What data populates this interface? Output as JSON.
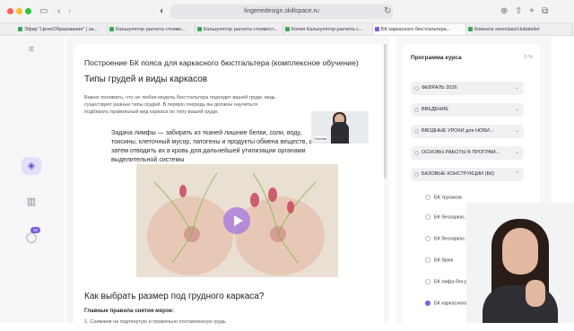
{
  "browser": {
    "url": "lingeriedesign.skillspace.ru",
    "tabs": [
      {
        "label": "Эфир \"ЦеноОбразование\" | за..."
      },
      {
        "label": "Калькулятор расчета стоимо..."
      },
      {
        "label": "Калькулятор расчета стоимост..."
      },
      {
        "label": "Копия Калькулятор расчета с..."
      },
      {
        "label": "БК каркасного бюстгальтера..."
      },
      {
        "label": "Комната sereclass/clubatelier"
      }
    ]
  },
  "rail": {
    "badge": "33"
  },
  "lesson": {
    "title": "Построение БК пояса для каркасного бюстгальтера (комплексное обучение)",
    "section1": "Типы грудей и виды каркасов",
    "intro": "Важно понимать, что не любая модель бюстгальтера подходит вашей груди, ведь существуют разные типы грудей. В первую очередь вы должны научиться подбирать правильный вид каркаса по типу вашей груди.",
    "quote": "Задача лимфы — забирать из тканей лишние белки, соли, воду, токсины, клеточный мусор, патогены и продукты обмена веществ, а затем отводить их в кровь для дальнейшей утилизации органами выделительной системы",
    "section2": "Как выбрать размер под грудного каркаса?",
    "rules_title": "Главные правила снятия мерок:",
    "rule1": "1. Снимаем на подтянутую и правильно поставленную грудь"
  },
  "webcam_small": {
    "label": "Полина"
  },
  "program": {
    "title": "Программа курса",
    "progress": "0 %",
    "modules": [
      {
        "label": "ФЕВРАЛЬ 2026"
      },
      {
        "label": "ВВЕДЕНИЕ"
      },
      {
        "label": "ВВОДНЫЕ УРОКИ для НОВИ..."
      },
      {
        "label": "ОСНОВЫ РАБОТЫ В ПРОГРАМ..."
      },
      {
        "label": "БАЗОВЫЕ КОНСТРУКЦИИ (БК)"
      }
    ],
    "lessons": [
      {
        "label": "БК трусиков"
      },
      {
        "label": "БК бескаркас..."
      },
      {
        "label": "БК бескаркас..."
      },
      {
        "label": "БК брюк"
      },
      {
        "label": "БК лифа без р..."
      },
      {
        "label": "БК каркасного..."
      }
    ]
  },
  "colors": {
    "accent": "#7b5ae0",
    "play": "#b086d8"
  }
}
